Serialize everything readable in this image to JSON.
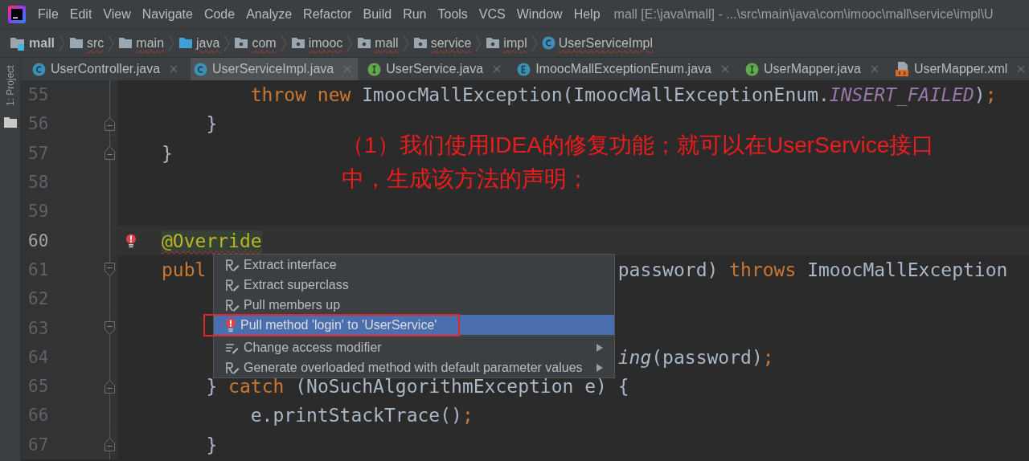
{
  "menu_bar": {
    "items": [
      "File",
      "Edit",
      "View",
      "Navigate",
      "Code",
      "Analyze",
      "Refactor",
      "Build",
      "Run",
      "Tools",
      "VCS",
      "Window",
      "Help"
    ],
    "title": "mall [E:\\java\\mall] - ...\\src\\main\\java\\com\\imooc\\mall\\service\\impl\\U"
  },
  "breadcrumbs": [
    {
      "label": "mall",
      "kind": "module",
      "error": false
    },
    {
      "label": "src",
      "kind": "folder",
      "error": true
    },
    {
      "label": "main",
      "kind": "folder",
      "error": true
    },
    {
      "label": "java",
      "kind": "source-folder",
      "error": true
    },
    {
      "label": "com",
      "kind": "package",
      "error": true
    },
    {
      "label": "imooc",
      "kind": "package",
      "error": true
    },
    {
      "label": "mall",
      "kind": "package",
      "error": true
    },
    {
      "label": "service",
      "kind": "package",
      "error": true
    },
    {
      "label": "impl",
      "kind": "package",
      "error": true
    },
    {
      "label": "UserServiceImpl",
      "kind": "class",
      "error": true
    }
  ],
  "tool_strip": {
    "label": "1: Project"
  },
  "tabs": [
    {
      "label": "UserController.java",
      "kind": "class",
      "selected": false
    },
    {
      "label": "UserServiceImpl.java",
      "kind": "class",
      "selected": true
    },
    {
      "label": "UserService.java",
      "kind": "interface",
      "selected": false
    },
    {
      "label": "ImoocMallExceptionEnum.java",
      "kind": "enum",
      "selected": false
    },
    {
      "label": "UserMapper.java",
      "kind": "interface",
      "selected": false
    },
    {
      "label": "UserMapper.xml",
      "kind": "xml",
      "selected": false
    }
  ],
  "editor": {
    "lines": [
      {
        "number": "55",
        "current": false,
        "fold_open": false,
        "fold_close": false,
        "bulb": false,
        "segments": [
          {
            "text": "        throw new",
            "kind": "keyword"
          },
          {
            "text": " ImoocMallException(ImoocMallExceptionEnum.",
            "kind": "plain"
          },
          {
            "text": "INSERT_FAILED",
            "kind": "constant"
          },
          {
            "text": ")",
            "kind": "plain"
          },
          {
            "text": ";",
            "kind": "punct"
          }
        ]
      },
      {
        "number": "56",
        "current": false,
        "fold_open": false,
        "fold_close": true,
        "bulb": false,
        "segments": [
          {
            "text": "    }",
            "kind": "plain"
          }
        ]
      },
      {
        "number": "57",
        "current": false,
        "fold_open": false,
        "fold_close": true,
        "bulb": false,
        "segments": [
          {
            "text": "}",
            "kind": "plain"
          }
        ]
      },
      {
        "number": "58",
        "current": false,
        "fold_open": false,
        "fold_close": false,
        "bulb": false
      },
      {
        "number": "59",
        "current": false,
        "fold_open": false,
        "fold_close": false,
        "bulb": false
      },
      {
        "number": "60",
        "current": true,
        "fold_open": false,
        "fold_close": false,
        "bulb": true,
        "segments": [
          {
            "text": "@Override",
            "kind": "annotation",
            "error": true
          }
        ]
      },
      {
        "number": "61",
        "current": false,
        "fold_open": true,
        "fold_close": false,
        "bulb": false,
        "segments": [
          {
            "text": "publ",
            "kind": "keyword",
            "after_menu": false
          },
          {
            "text": "password) ",
            "kind": "plain",
            "after_menu": true
          },
          {
            "text": "throws",
            "kind": "keyword",
            "after_menu": true
          },
          {
            "text": " ImoocMallException",
            "kind": "plain",
            "after_menu": true
          }
        ]
      },
      {
        "number": "62",
        "current": false,
        "fold_open": false,
        "fold_close": false,
        "bulb": false
      },
      {
        "number": "63",
        "current": false,
        "fold_open": true,
        "fold_close": false,
        "bulb": false
      },
      {
        "number": "64",
        "current": false,
        "fold_open": false,
        "fold_close": false,
        "bulb": false,
        "segments": [
          {
            "text": "ing",
            "kind": "call",
            "after_menu": true
          },
          {
            "text": "(password)",
            "kind": "plain",
            "after_menu": true
          },
          {
            "text": ";",
            "kind": "punct",
            "after_menu": true
          }
        ]
      },
      {
        "number": "65",
        "current": false,
        "fold_open": false,
        "fold_close": true,
        "bulb": false,
        "segments": [
          {
            "text": "    } ",
            "kind": "plain"
          },
          {
            "text": "catch",
            "kind": "keyword"
          },
          {
            "text": " (NoSuchAlgorithmException e) {",
            "kind": "plain"
          }
        ]
      },
      {
        "number": "66",
        "current": false,
        "fold_open": false,
        "fold_close": false,
        "bulb": false,
        "segments": [
          {
            "text": "        e.printStackTrace()",
            "kind": "plain"
          },
          {
            "text": ";",
            "kind": "punct"
          }
        ]
      },
      {
        "number": "67",
        "current": false,
        "fold_open": false,
        "fold_close": true,
        "bulb": false,
        "segments": [
          {
            "text": "    }",
            "kind": "plain"
          }
        ]
      }
    ]
  },
  "popup": {
    "items": [
      {
        "label": "Extract interface",
        "kind": "refactor",
        "selected": false,
        "submenu": false
      },
      {
        "label": "Extract superclass",
        "kind": "refactor",
        "selected": false,
        "submenu": false
      },
      {
        "label": "Pull members up",
        "kind": "refactor",
        "selected": false,
        "submenu": false
      },
      {
        "label": "Pull method 'login' to 'UserService'",
        "kind": "bulb",
        "selected": true,
        "submenu": false
      },
      {
        "label": "Change access modifier",
        "kind": "modifier",
        "selected": false,
        "submenu": true,
        "separator_before": true
      },
      {
        "label": "Generate overloaded method with default parameter values",
        "kind": "refactor",
        "selected": false,
        "submenu": true
      }
    ]
  },
  "annotation": {
    "lines": [
      "（1）我们使用IDEA的修复功能；就可以在UserService接口",
      "中，生成该方法的声明；"
    ]
  }
}
